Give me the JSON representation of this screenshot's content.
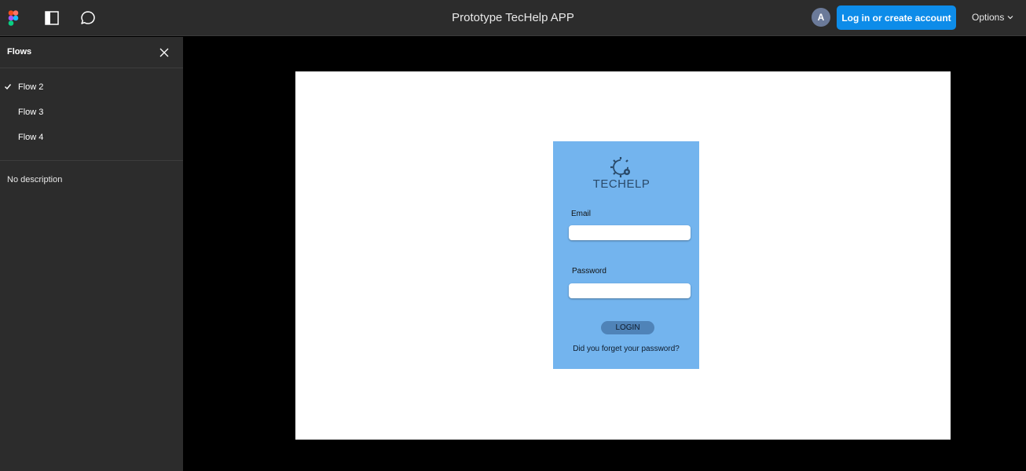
{
  "topbar": {
    "title": "Prototype TecHelp APP",
    "avatar_initial": "A",
    "login_label": "Log in or create account",
    "options_label": "Options",
    "icons": [
      "figma-logo-icon",
      "panel-toggle-icon",
      "comment-icon",
      "chevron-down-icon"
    ]
  },
  "sidebar": {
    "title": "Flows",
    "flows": [
      {
        "label": "Flow 2",
        "selected": true
      },
      {
        "label": "Flow 3",
        "selected": false
      },
      {
        "label": "Flow 4",
        "selected": false
      }
    ],
    "description": "No description"
  },
  "prototype": {
    "brand": "TECHELP",
    "email_label": "Email",
    "email_value": "",
    "password_label": "Password",
    "password_value": "",
    "login_button": "LOGIN",
    "forgot_link": "Did you forget your password?"
  },
  "colors": {
    "topbar_bg": "#2c2c2c",
    "accent_blue": "#0d8ce9",
    "phone_bg": "#73b4ee",
    "login_pill": "#4f83b8"
  }
}
